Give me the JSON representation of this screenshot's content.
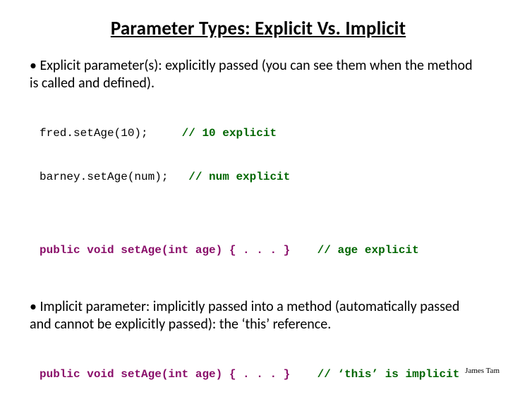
{
  "title": "Parameter Types: Explicit Vs. Implicit",
  "bullet1": "Explicit parameter(s): explicitly passed (you can see them when the method is called and defined).",
  "code1": {
    "line1a": "fred.setAge(10);     ",
    "line1b": "// 10 explicit",
    "line2a": "barney.setAge(num);   ",
    "line2b": "// num explicit",
    "line3a": "public void setAge(int age) { . . . }    ",
    "line3b": "// age explicit"
  },
  "bullet2": "Implicit parameter: implicitly passed into a method (automatically passed and cannot be explicitly passed): the ‘this’ reference.",
  "code2": {
    "line1a": "public void setAge(int age) { . . . }    ",
    "line1b": "// ‘this’ is implicit"
  },
  "footer": "James Tam"
}
